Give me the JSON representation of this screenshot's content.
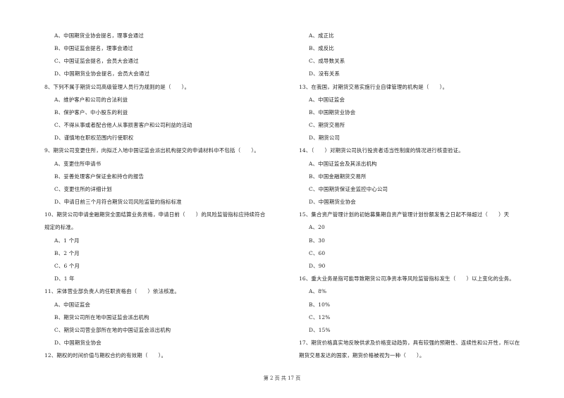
{
  "left_column": {
    "q7_options": [
      "A、中国期货业协会提名，理事会通过",
      "B、中国证监会提名，理事会通过",
      "C、中国证监会提名，会员大会通过",
      "D、中国期货业协会提名，会员大会通过"
    ],
    "q8": {
      "stem": "8、下列不属于期货公司高级管理人员行为规则的是（　　）。",
      "options": [
        "A、维护客户和公司的合法利益",
        "B、保护客户、中小股东的利益",
        "C、不得从事或者配合他人从事损害客户和公司利益的活动",
        "D、谨慎地在职权范围内行使职权"
      ]
    },
    "q9": {
      "stem": "9、期货公司变更住所，向拟迁入地中国证监会派出机构提交的申请材料中不包括（　　）。",
      "options": [
        "A、变更住所申请书",
        "B、妥善处理客户保证金和持仓的报告",
        "C、变更住所的详细计划",
        "D、申请日前三个月符合期货公司风险监管的指标标准"
      ]
    },
    "q10": {
      "stem_line1": "10、期货公司申请金融期货全面结算业务资格，申请日前（　　）的风险监管指标应持续符合",
      "stem_line2": "规定的标准。",
      "options": [
        "A、1 个月",
        "B、2 个月",
        "C、6 个月",
        "D、1 年"
      ]
    },
    "q11": {
      "stem": "11、宋体营业部负责人的任职资格由（　　）依法核准。",
      "options": [
        "A、中国证监会",
        "B、期货公司所在地中国证监会派出机构",
        "C、期货公司营业部所在地的中国证监会派出机构",
        "D、中国期货业协会"
      ]
    },
    "q12": {
      "stem": "12、期权的时间价值与期权合约的有效期（　　）。"
    }
  },
  "right_column": {
    "q12_options": [
      "A、成正比",
      "B、成反比",
      "C、成导数关系",
      "D、没有关系"
    ],
    "q13": {
      "stem": "13、在我国，对期货交易实施行业自律管理的机构是（　　）。",
      "options": [
        "A、中国证监会",
        "B、中国期货业协会",
        "C、期货交易所",
        "D、期货公司"
      ]
    },
    "q14": {
      "stem": "14、（　　）对期货公司执行投资者适当性制度的情况进行核查验证。",
      "options": [
        "A、中国证监会及其派出机构",
        "B、中国金融期货交易所",
        "C、中国期货保证金监控中心公司",
        "D、中国期货业协会"
      ]
    },
    "q15": {
      "stem": "15、集合资产管理计划的初始募集期自资产管理计划份额发售之日起不得超过（　　）天",
      "options": [
        "A、20",
        "B、30",
        "C、60",
        "D、90"
      ]
    },
    "q16": {
      "stem": "16、重大业务是指可能导致期货公司净资本等风险监管指标发生（　　）以上变化的业务。",
      "options": [
        "A、8%",
        "B、10%",
        "C、12%",
        "D、15%"
      ]
    },
    "q17": {
      "stem_line1": "17、期货价格真实地反映供求及价格变动趋势，具有较强的预期性、连续性和公开性，所以在",
      "stem_line2": "期货交易发达的国家，期货价格被视为一种（　　）。"
    }
  },
  "footer": {
    "page_label": "第 2 页 共 17 页"
  }
}
